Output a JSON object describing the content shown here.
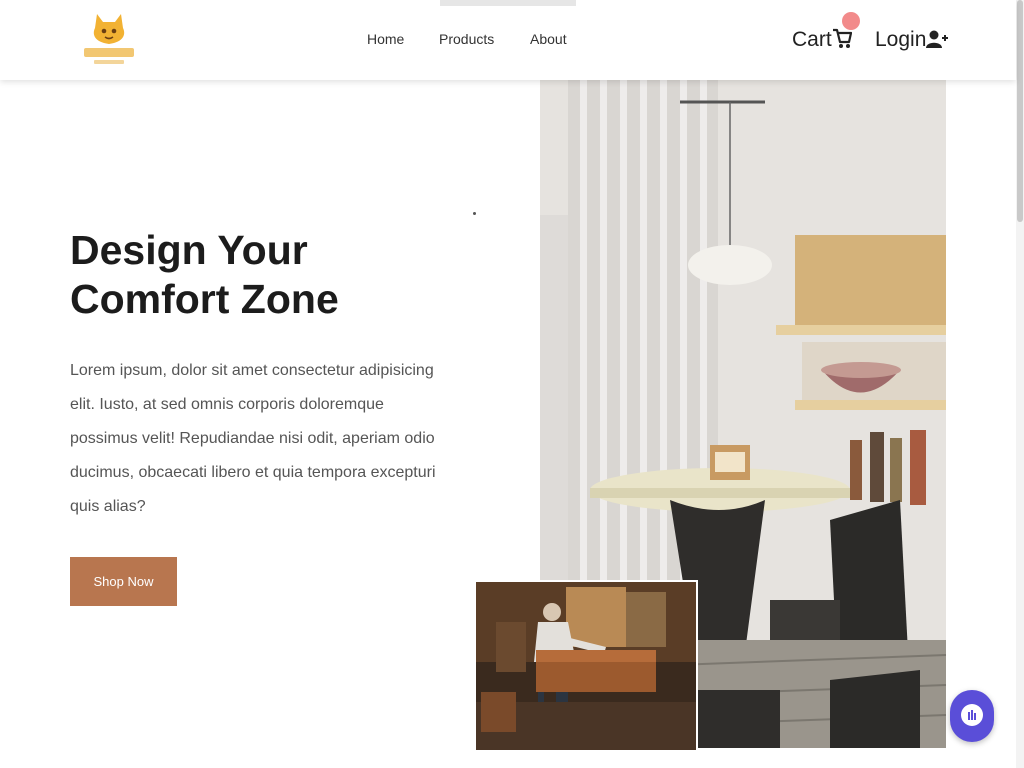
{
  "header": {
    "nav": [
      {
        "label": "Home"
      },
      {
        "label": "Products"
      },
      {
        "label": "About"
      }
    ],
    "cart_label": "Cart",
    "login_label": "Login"
  },
  "hero": {
    "title_line1": "Design Your",
    "title_line2": "Comfort Zone",
    "description": "Lorem ipsum, dolor sit amet consectetur adipisicing elit. Iusto, at sed omnis corporis doloremque possimus velit! Repudiandae nisi odit, aperiam odio ducimus, obcaecati libero et quia tempora excepturi quis alias?",
    "cta_label": "Shop Now"
  },
  "icons": {
    "logo": "logo-icon",
    "cart": "cart-icon",
    "user": "user-plus-icon",
    "chat": "chat-icon"
  },
  "colors": {
    "accent": "#b8764f",
    "chat": "#5a4ed8",
    "badge": "#f28a8a"
  }
}
